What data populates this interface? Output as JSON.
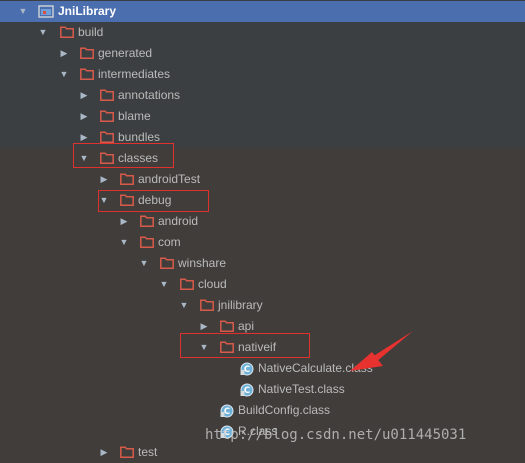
{
  "colors": {
    "background": "#3c3f41",
    "selection": "#4b6eaf",
    "folder": "#d85a4a",
    "class_icon": "#6fb1d9",
    "highlight_box": "#e0312f",
    "annotation_arrow": "#e8322f"
  },
  "tree": {
    "root": {
      "label": "JniLibrary",
      "icon": "module-icon"
    },
    "build": {
      "label": "build",
      "icon": "folder-icon"
    },
    "generated": {
      "label": "generated",
      "icon": "folder-icon"
    },
    "intermediates": {
      "label": "intermediates",
      "icon": "folder-icon"
    },
    "annotations": {
      "label": "annotations",
      "icon": "folder-icon"
    },
    "blame": {
      "label": "blame",
      "icon": "folder-icon"
    },
    "bundles": {
      "label": "bundles",
      "icon": "folder-icon"
    },
    "classes": {
      "label": "classes",
      "icon": "folder-icon"
    },
    "androidTest": {
      "label": "androidTest",
      "icon": "folder-icon"
    },
    "debug": {
      "label": "debug",
      "icon": "folder-icon"
    },
    "android": {
      "label": "android",
      "icon": "folder-icon"
    },
    "com": {
      "label": "com",
      "icon": "folder-icon"
    },
    "winshare": {
      "label": "winshare",
      "icon": "folder-icon"
    },
    "cloud": {
      "label": "cloud",
      "icon": "folder-icon"
    },
    "jnilibrary": {
      "label": "jnilibrary",
      "icon": "folder-icon"
    },
    "api": {
      "label": "api",
      "icon": "folder-icon"
    },
    "nativeif": {
      "label": "nativeif",
      "icon": "folder-icon"
    },
    "nativeCalculate": {
      "label": "NativeCalculate.class",
      "icon": "class-file-icon"
    },
    "nativeTest": {
      "label": "NativeTest.class",
      "icon": "class-file-icon"
    },
    "buildConfig": {
      "label": "BuildConfig.class",
      "icon": "class-file-icon"
    },
    "rClass": {
      "label": "R.class",
      "icon": "class-file-icon"
    },
    "test": {
      "label": "test",
      "icon": "folder-icon"
    }
  },
  "watermark": "http://blog.csdn.net/u011445031"
}
